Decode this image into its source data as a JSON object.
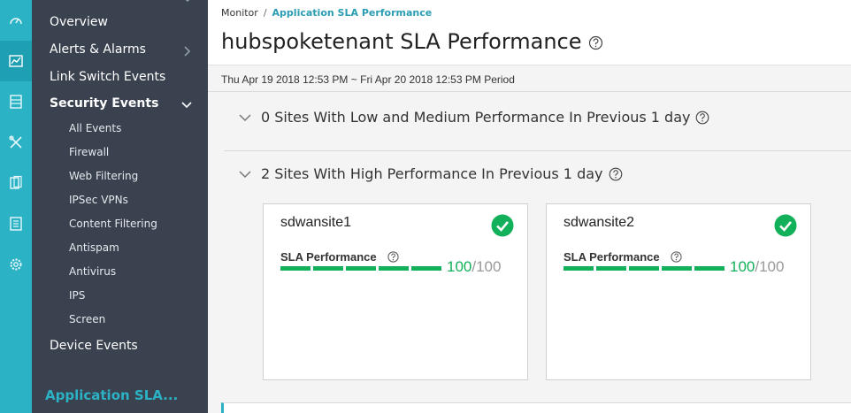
{
  "rail": {
    "icons": [
      "dashboard-icon",
      "monitor-chart-icon",
      "devices-icon",
      "configure-tools-icon",
      "reports-icon",
      "logs-icon",
      "settings-gear-icon"
    ],
    "active_index": 1,
    "accent": "#2bb2c5"
  },
  "nav": {
    "items": [
      {
        "label": "Overview"
      },
      {
        "label": "Alerts & Alarms"
      },
      {
        "label": "Link Switch Events"
      },
      {
        "label": "Security Events"
      },
      {
        "label": "Device Events"
      }
    ],
    "security_sub": [
      {
        "label": "All Events"
      },
      {
        "label": "Firewall"
      },
      {
        "label": "Web Filtering"
      },
      {
        "label": "IPSec VPNs"
      },
      {
        "label": "Content Filtering"
      },
      {
        "label": "Antispam"
      },
      {
        "label": "Antivirus"
      },
      {
        "label": "IPS"
      },
      {
        "label": "Screen"
      }
    ],
    "current_app": "Application SLA..."
  },
  "breadcrumb": {
    "root": "Monitor",
    "separator": "/",
    "current": "Application SLA Performance"
  },
  "page": {
    "title": "hubspoketenant SLA Performance",
    "period": "Thu Apr 19 2018 12:53 PM ~ Fri Apr 20 2018 12:53 PM Period"
  },
  "sections": [
    {
      "heading": "0 Sites With Low and Medium Performance In Previous 1 day"
    },
    {
      "heading": "2 Sites With High Performance In Previous 1 day"
    }
  ],
  "sites": [
    {
      "name": "sdwansite1",
      "metric_label": "SLA Performance",
      "score": "100",
      "max": "/100",
      "status": "ok"
    },
    {
      "name": "sdwansite2",
      "metric_label": "SLA Performance",
      "score": "100",
      "max": "/100",
      "status": "ok"
    }
  ],
  "colors": {
    "good": "#12b05a",
    "link": "#2a9db3",
    "nav_bg": "#3a4250"
  }
}
